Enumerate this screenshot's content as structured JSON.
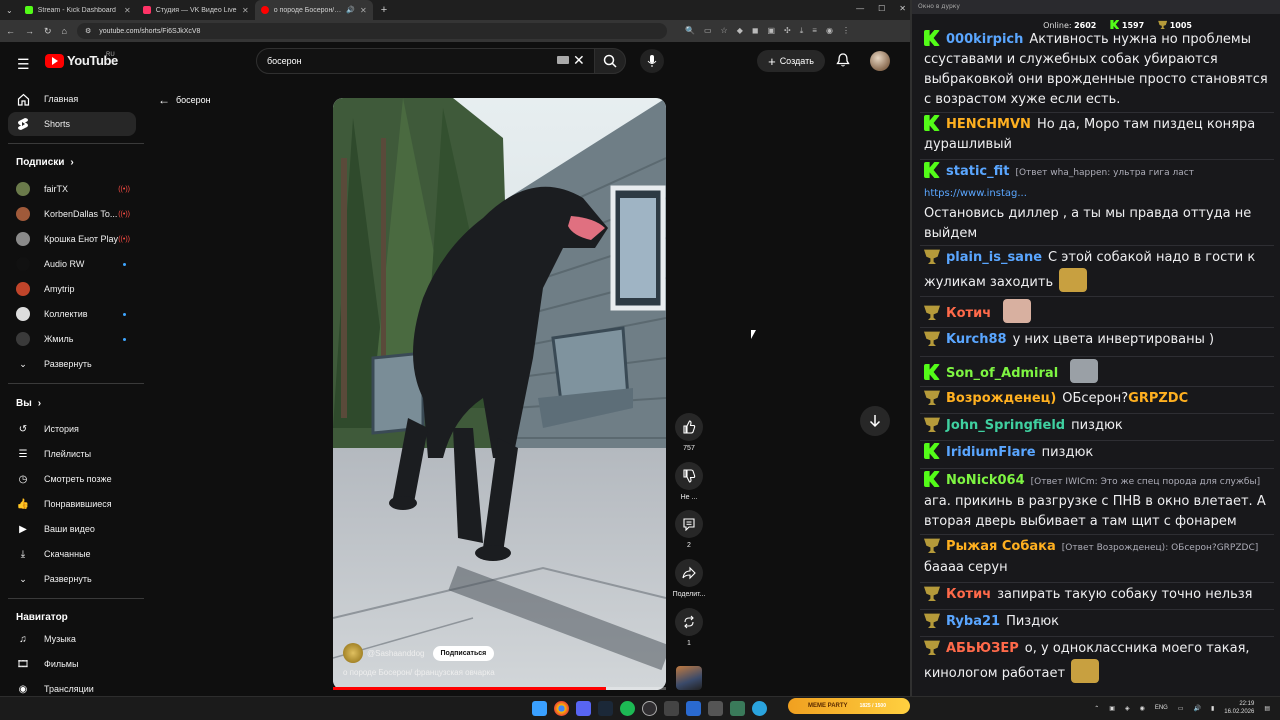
{
  "browser": {
    "tabs": [
      {
        "title": "Stream - Kick Dashboard",
        "color": "#53fc18"
      },
      {
        "title": "Студия — VK Видео Live",
        "color": "#ff3366"
      },
      {
        "title": "о породе Босерон/ франц",
        "color": "#ff0000"
      }
    ],
    "url": "youtube.com/shorts/Fi6SJkXcV8"
  },
  "youtube": {
    "logo_text": "YouTube",
    "region": "RU",
    "search_value": "босерон",
    "create_label": "Создать",
    "back_label": "босерон"
  },
  "sidebar": {
    "main": [
      {
        "label": "Главная",
        "icon": "home-icon"
      },
      {
        "label": "Shorts",
        "icon": "shorts-icon"
      }
    ],
    "subs_title": "Подписки",
    "subs": [
      {
        "label": "fairTX",
        "status": "live",
        "color": "#6a7a4a"
      },
      {
        "label": "KorbenDallas To...",
        "status": "live",
        "color": "#a05a3a"
      },
      {
        "label": "Крошка Енот Play",
        "status": "live",
        "color": "#8a8a8a"
      },
      {
        "label": "Audio RW",
        "status": "new",
        "color": "#111111"
      },
      {
        "label": "Amytrip",
        "status": "",
        "color": "#c0442a"
      },
      {
        "label": "Коллектив",
        "status": "new",
        "color": "#dddddd"
      },
      {
        "label": "Жмиль",
        "status": "new",
        "color": "#3a3a3a"
      }
    ],
    "expand1": "Развернуть",
    "you_title": "Вы",
    "you": [
      {
        "label": "История",
        "icon": "history-icon"
      },
      {
        "label": "Плейлисты",
        "icon": "playlists-icon"
      },
      {
        "label": "Смотреть позже",
        "icon": "watch-later-icon"
      },
      {
        "label": "Понравившиеся",
        "icon": "liked-icon"
      },
      {
        "label": "Ваши видео",
        "icon": "your-videos-icon"
      },
      {
        "label": "Скачанные",
        "icon": "downloads-icon"
      }
    ],
    "expand2": "Развернуть",
    "nav_title": "Навигатор",
    "nav": [
      {
        "label": "Музыка",
        "icon": "music-icon"
      },
      {
        "label": "Фильмы",
        "icon": "films-icon"
      },
      {
        "label": "Трансляции",
        "icon": "live-icon"
      }
    ]
  },
  "short": {
    "likes": "757",
    "dislike_label": "Не ...",
    "comments": "2",
    "share_label": "Поделит...",
    "remix": "1",
    "channel": "@Sashaanddog",
    "subscribe_label": "Подписаться",
    "title": "о породе Босерон/ французская овчарка",
    "progress": 0.82
  },
  "chat": {
    "window_title": "Окно в дурку",
    "online_label": "Online:",
    "online": "2602",
    "kick_count": "1597",
    "cup_count": "1005",
    "messages": [
      {
        "badge": "kick",
        "nick": "000kirpich",
        "nick_color": "#5aa6ff",
        "text": "Активность нужна но проблемы ссуставами и служебных собак убираются выбраковкой они врожденные просто становятся с возрастом хуже если есть."
      },
      {
        "badge": "kick",
        "nick": "HENCHMVN",
        "nick_color": "#ffb020",
        "text": "Но да, Моро там пиздец коняра дурашливый"
      },
      {
        "badge": "kick",
        "nick": "static_fit",
        "nick_color": "#5aa6ff",
        "reply": "[Ответ wha_happen: ультра гига ласт",
        "link": "https://www.instag...",
        "text": "Остановись диллер , а ты мы правда оттуда не выйдем"
      },
      {
        "badge": "cup",
        "nick": "plain_is_sane",
        "nick_color": "#5aa6ff",
        "text": "С этой собакой надо в гости к жуликам заходить"
      },
      {
        "badge": "cup",
        "nick": "Котич",
        "nick_color": "#ff6a4a",
        "text": ""
      },
      {
        "badge": "cup",
        "nick": "Kurch88",
        "nick_color": "#5aa6ff",
        "text": "у них цвета инвертированы )"
      },
      {
        "badge": "kick",
        "nick": "Son_of_Admiral",
        "nick_color": "#7ef542",
        "text": ""
      },
      {
        "badge": "cup",
        "nick": "Возрожденец)",
        "nick_color": "#ffb020",
        "text": "ОБсерон?",
        "highlight": "GRPZDC"
      },
      {
        "badge": "cup",
        "nick": "John_Springfield",
        "nick_color": "#3fd0a0",
        "text": "пиздюк"
      },
      {
        "badge": "kick",
        "nick": "IridiumFlare",
        "nick_color": "#5aa6ff",
        "text": "пиздюк"
      },
      {
        "badge": "kick",
        "nick": "NoNick064",
        "nick_color": "#7ef542",
        "reply": "[Ответ IWICm: Это же спец порода для службы]",
        "text": "ага. прикинь в разгрузке с ПНВ в окно влетает. А вторая дверь выбивает а там щит с фонарем"
      },
      {
        "badge": "cup",
        "nick": "Рыжая Собака",
        "nick_color": "#ffb020",
        "reply": "[Ответ Возрожденец): ОБсерон?GRPZDC]",
        "text": "бааaa серун"
      },
      {
        "badge": "cup",
        "nick": "Котич",
        "nick_color": "#ff6a4a",
        "text": "запирать такую собаку точно нельзя"
      },
      {
        "badge": "cup",
        "nick": "Ryba21",
        "nick_color": "#5aa6ff",
        "text": "Пиздюк"
      },
      {
        "badge": "cup",
        "nick": "АБЬЮЗЕР",
        "nick_color": "#ff6a4a",
        "text": "о, у одноклассника моего такая, кинологом работает"
      }
    ]
  },
  "taskbar": {
    "meme_label": "MEME PARTY",
    "meme_value": "1825 / 1500",
    "lang": "ENG",
    "time": "22:19",
    "date": "16.02.2026"
  }
}
